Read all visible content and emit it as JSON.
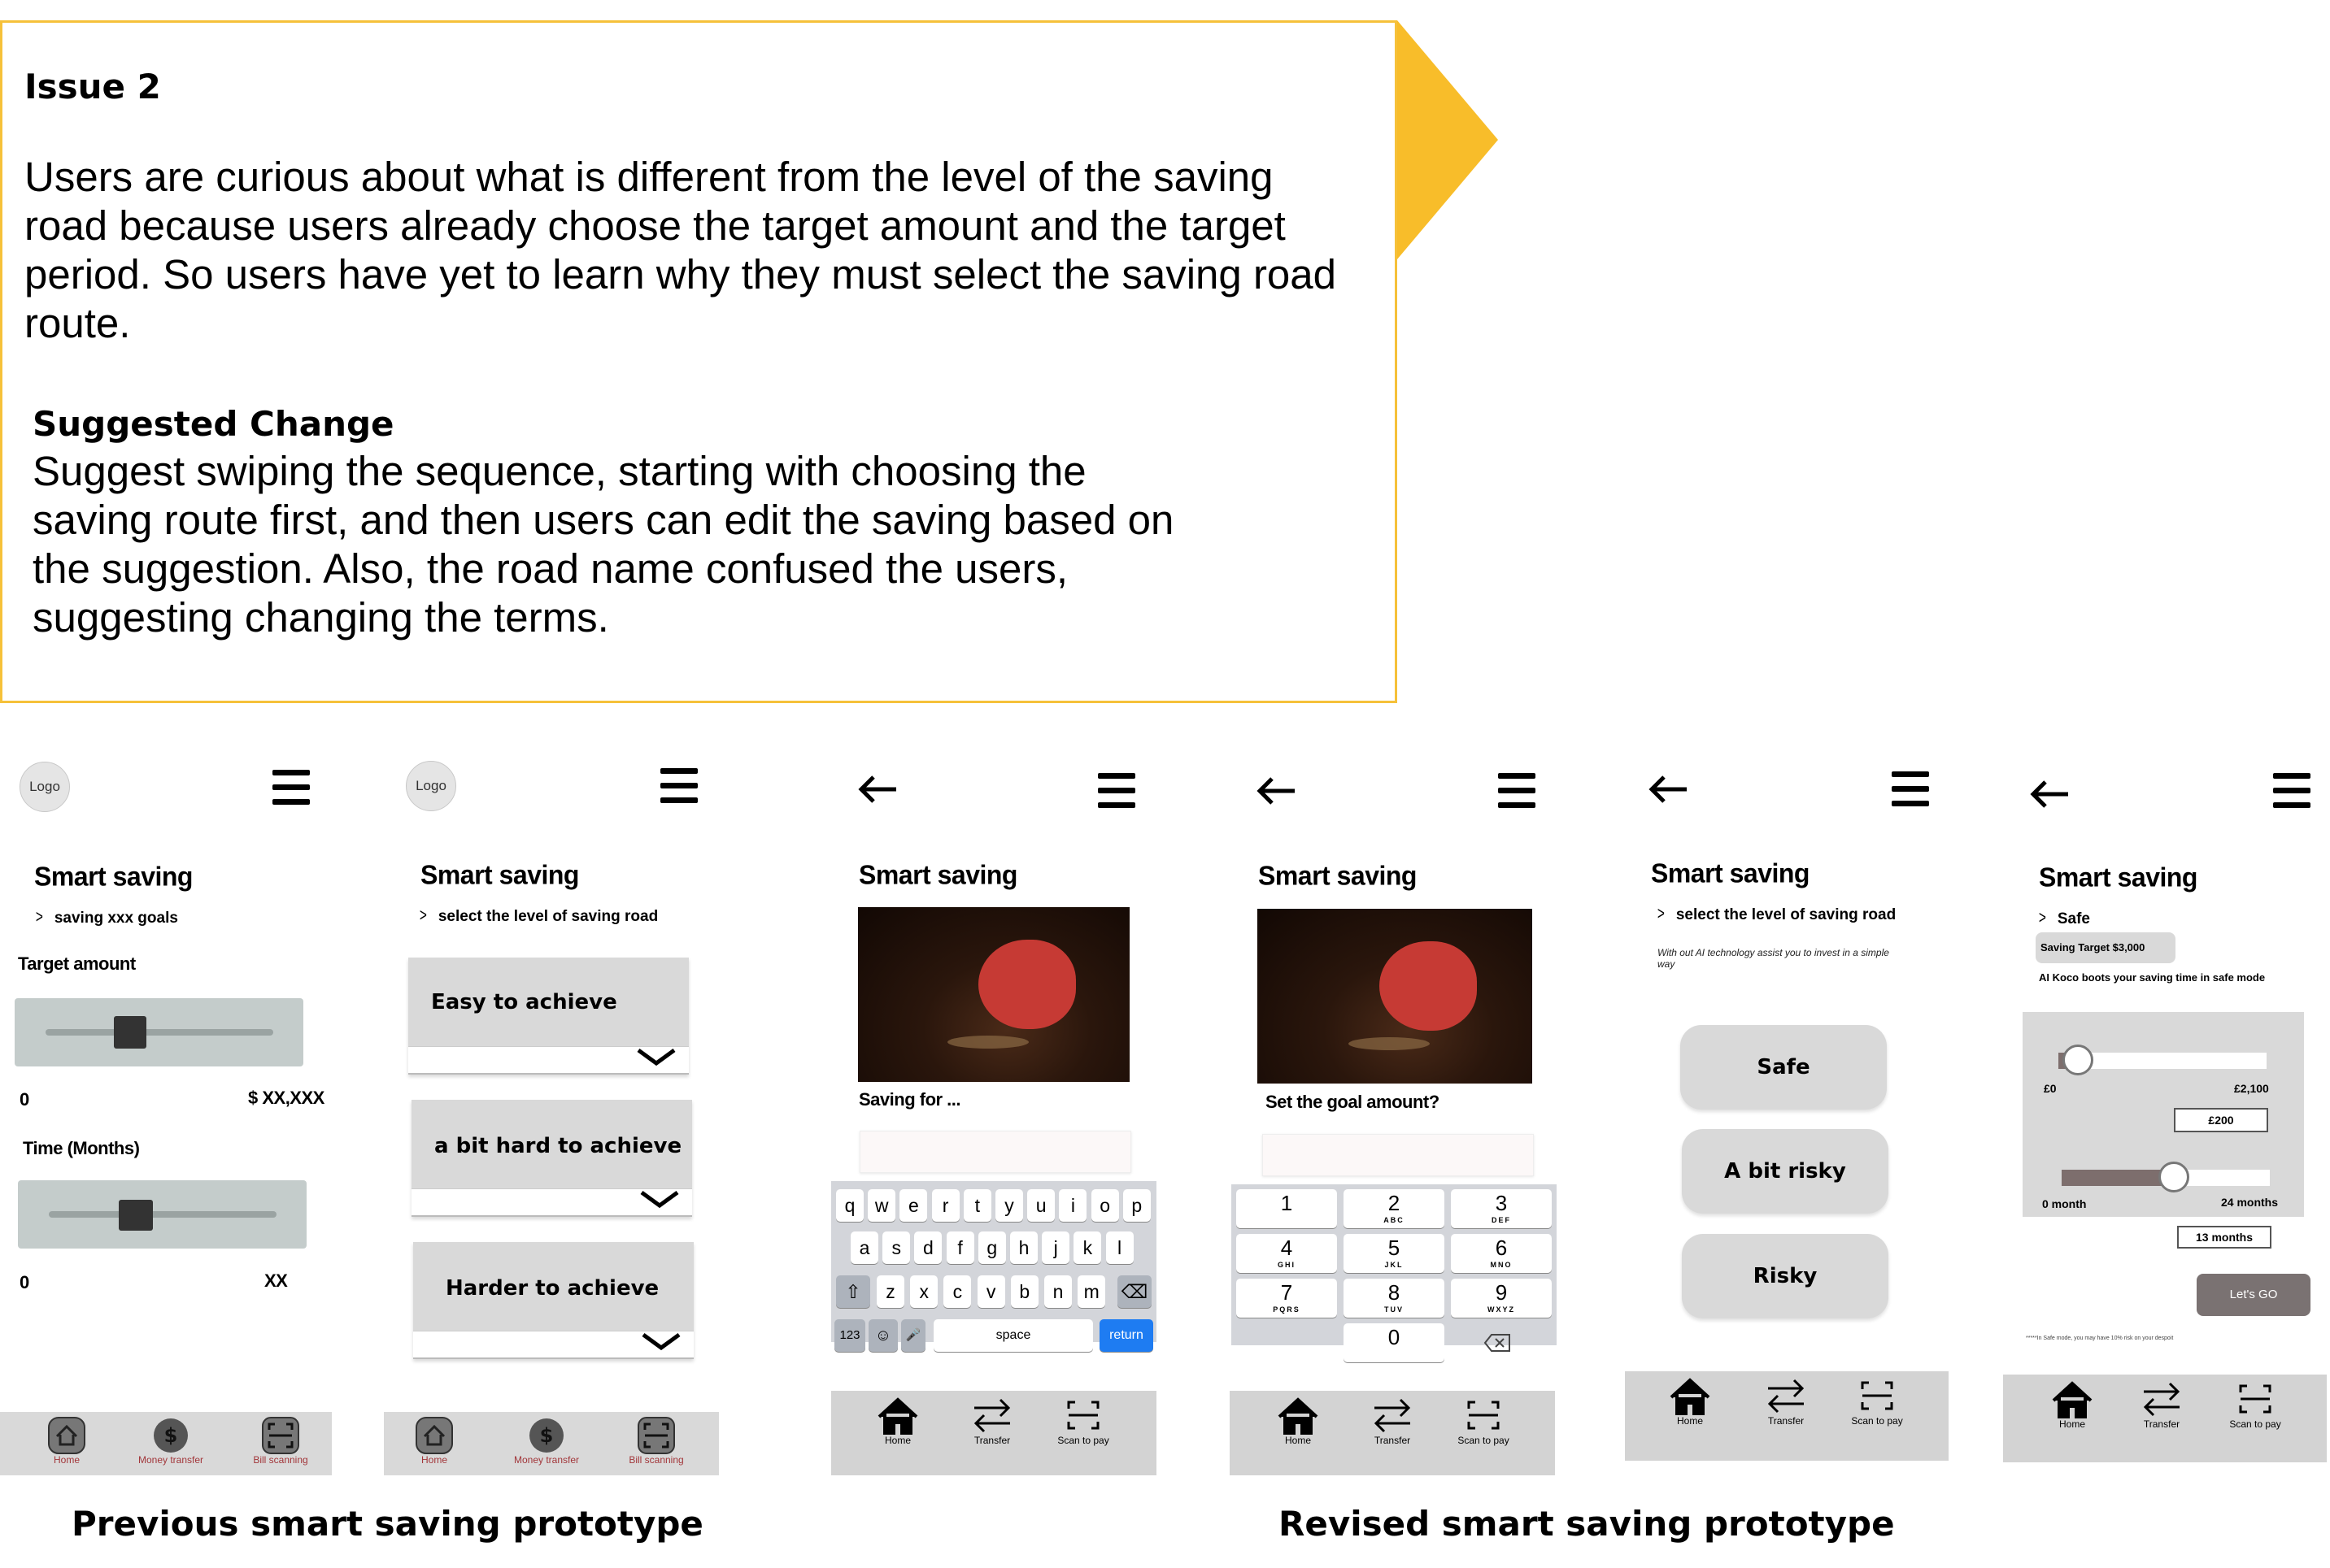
{
  "issue": {
    "title": "Issue 2",
    "body_lines": [
      "Users are curious about what is different from the level of the saving",
      "road because users already choose the target amount and the target",
      "period. So users have yet to learn why they must select the saving road",
      "route."
    ],
    "suggested_title": "Suggested Change",
    "suggested_lines": [
      "Suggest swiping the sequence, starting with choosing the",
      "saving route first, and then users can edit the saving based on",
      "the suggestion. Also, the road name confused the users,",
      "suggesting changing the terms."
    ]
  },
  "captions": {
    "previous": "Previous smart saving prototype",
    "revised": "Revised smart saving prototype"
  },
  "colors": {
    "accent_yellow": "#f8bd2a",
    "nav_red": "#a2363a",
    "keyboard_blue": "#1e7cf2"
  },
  "phone1": {
    "logo": "Logo",
    "title": "Smart saving",
    "subtitle": "saving xxx goals",
    "target_label": "Target amount",
    "target_min": "0",
    "target_max": "$ XX,XXX",
    "time_label": "Time (Months)",
    "time_min": "0",
    "time_max": "XX",
    "nav": [
      "Home",
      "Money transfer",
      "Bill scanning"
    ]
  },
  "phone2": {
    "logo": "Logo",
    "title": "Smart saving",
    "subtitle": "select the level of saving road",
    "options": [
      "Easy to achieve",
      "a bit hard to achieve",
      "Harder to achieve"
    ],
    "nav": [
      "Home",
      "Money transfer",
      "Bill scanning"
    ]
  },
  "phone3": {
    "title": "Smart saving",
    "photo_caption": "Saving for ...",
    "keyboard_rows": [
      [
        "q",
        "w",
        "e",
        "r",
        "t",
        "y",
        "u",
        "i",
        "o",
        "p"
      ],
      [
        "a",
        "s",
        "d",
        "f",
        "g",
        "h",
        "j",
        "k",
        "l"
      ],
      [
        "z",
        "x",
        "c",
        "v",
        "b",
        "n",
        "m"
      ]
    ],
    "key_123": "123",
    "key_space": "space",
    "key_return": "return",
    "nav": [
      "Home",
      "Transfer",
      "Scan to pay"
    ]
  },
  "phone4": {
    "title": "Smart saving",
    "photo_caption": "Set the goal amount?",
    "numpad": [
      {
        "n": "1",
        "l": ""
      },
      {
        "n": "2",
        "l": "ABC"
      },
      {
        "n": "3",
        "l": "DEF"
      },
      {
        "n": "4",
        "l": "GHI"
      },
      {
        "n": "5",
        "l": "JKL"
      },
      {
        "n": "6",
        "l": "MNO"
      },
      {
        "n": "7",
        "l": "PQRS"
      },
      {
        "n": "8",
        "l": "TUV"
      },
      {
        "n": "9",
        "l": "WXYZ"
      },
      {
        "n": "0",
        "l": ""
      }
    ],
    "nav": [
      "Home",
      "Transfer",
      "Scan to pay"
    ]
  },
  "phone5": {
    "title": "Smart saving",
    "subtitle": "select the level of saving road",
    "description": "With out AI technology assist you to invest in a simple way",
    "options": [
      "Safe",
      "A bit risky",
      "Risky"
    ],
    "nav": [
      "Home",
      "Transfer",
      "Scan to pay"
    ]
  },
  "phone6": {
    "title": "Smart saving",
    "subtitle": "Safe",
    "target_chip": "Saving Target $3,000",
    "ai_note": "AI Koco boots your saving time in safe mode",
    "amount_min": "£0",
    "amount_max": "£2,100",
    "amount_value": "£200",
    "amount_fraction": 0.095,
    "month_min": "0 month",
    "month_max": "24 months",
    "month_value": "13 months",
    "month_fraction": 0.54,
    "cta": "Let's GO",
    "footnote": "*****In Safe mode, you may have 10% risk on your despoit",
    "nav": [
      "Home",
      "Transfer",
      "Scan to pay"
    ]
  }
}
